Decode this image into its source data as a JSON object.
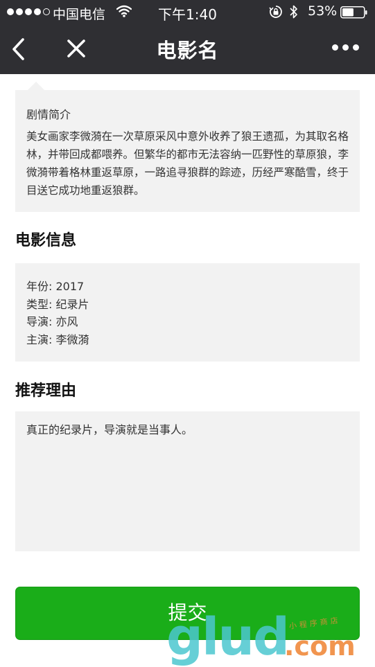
{
  "status_bar": {
    "carrier": "中国电信",
    "time": "下午1:40",
    "battery": "53%",
    "battery_level": 0.53
  },
  "nav": {
    "title": "电影名"
  },
  "synopsis": {
    "label": "剧情简介",
    "text": "美女画家李微漪在一次草原采风中意外收养了狼王遗孤，为其取名格林，并带回成都喂养。但繁华的都市无法容纳一匹野性的草原狼，李微漪带着格林重返草原，一路追寻狼群的踪迹，历经严寒酷雪，终于目送它成功地重返狼群。"
  },
  "movie_info": {
    "heading": "电影信息",
    "rows": [
      "年份: 2017",
      "类型: 纪录片",
      "导演: 亦风",
      "主演: 李微漪"
    ]
  },
  "recommend": {
    "heading": "推荐理由",
    "text": "真正的纪录片，导演就是当事人。"
  },
  "submit": {
    "label": "提交"
  },
  "watermark": {
    "brand": "glud",
    "domain": ".com",
    "tagline": "小程序商店"
  }
}
